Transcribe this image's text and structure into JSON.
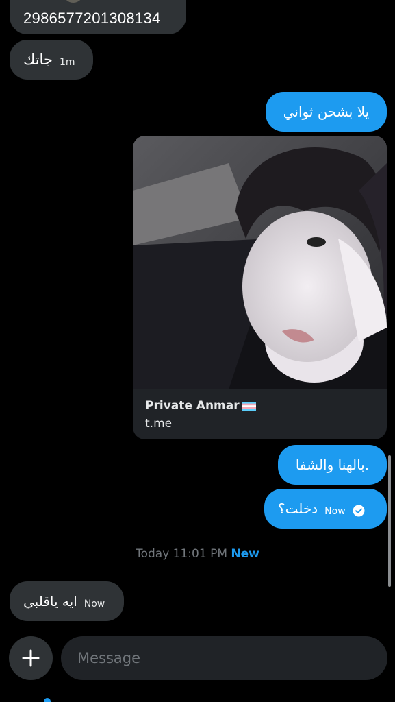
{
  "messages": {
    "m1_text": "2986577201308134",
    "m2_text": "جاتك",
    "m2_time": "1m",
    "m3_text": "يلا بشحن ثواني",
    "m4_text": "بالهنا والشفا.",
    "m5_text": "دخلت؟",
    "m5_time": "Now",
    "m6_text": "ايه ياقلبي",
    "m6_time": "Now"
  },
  "link_card": {
    "title": "Private Anmar",
    "domain": "t.me"
  },
  "divider": {
    "date": "Today 11:01 PM",
    "new_label": "New"
  },
  "composer": {
    "placeholder": "Message"
  },
  "colors": {
    "accent": "#1d9bf0",
    "incoming_bubble": "#2f3336",
    "background": "#000000"
  }
}
